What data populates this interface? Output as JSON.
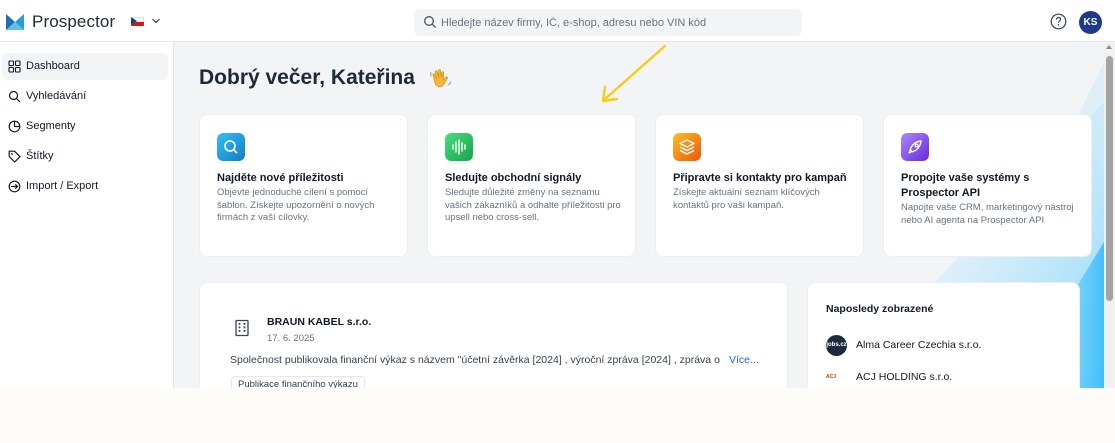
{
  "app": {
    "brand": "Prospector",
    "language_icon": "czech-flag-icon",
    "search_placeholder": "Hledejte název firmy, IČ, e-shop, adresu nebo VIN kód",
    "search_value": "",
    "user_initials": "KS"
  },
  "sidebar": {
    "items": [
      {
        "label": "Dashboard",
        "icon": "grid-icon",
        "active": true
      },
      {
        "label": "Vyhledávání",
        "icon": "search-icon",
        "active": false
      },
      {
        "label": "Segmenty",
        "icon": "pie-chart-icon",
        "active": false
      },
      {
        "label": "Štítky",
        "icon": "tag-icon",
        "active": false
      },
      {
        "label": "Import / Export",
        "icon": "import-export-icon",
        "active": false
      }
    ]
  },
  "main": {
    "greeting": "Dobrý večer, Kateřina",
    "cards": [
      {
        "title": "Najděte nové příležitosti",
        "description": "Objevte jednoduché cílení s pomocí šablon. Získejte upozornění o nových firmách z vaší cílovky.",
        "icon": "search-icon",
        "color": "#22a6d8"
      },
      {
        "title": "Sledujte obchodní signály",
        "description": "Sledujte důležité změny na seznamu vašich zákazníků a odhalte příležitosti pro upsell nebo cross-sell.",
        "icon": "signal-wave-icon",
        "color": "#22b14c"
      },
      {
        "title": "Připravte si kontakty pro kampaň",
        "description": "Získejte aktuální seznam klíčových kontaktů pro vaši kampaň.",
        "icon": "layers-icon",
        "color": "#f59e0b"
      },
      {
        "title": "Propojte vaše systémy s Prospector API",
        "description": "Napojte vaše CRM, marketingový nástroj nebo AI agenta na Prospector API",
        "icon": "rocket-icon",
        "color": "#7c3aed"
      }
    ],
    "feed": {
      "company": "BRAUN KABEL s.r.o.",
      "date": "17. 6. 2025",
      "text": "Společnost publikovala finanční výkaz s názvem \"účetní závěrka [2024] , výroční zpráva [2024] , zpráva o",
      "more_label": "Více...",
      "tag": "Publikace finančního výkazu"
    },
    "recent": {
      "title": "Naposledy zobrazené",
      "items": [
        {
          "name": "Alma Career Czechia s.r.o.",
          "logo_text": "jobs.cz"
        },
        {
          "name": "ACJ HOLDING s.r.o.",
          "logo_text": "ACJ"
        }
      ]
    }
  }
}
